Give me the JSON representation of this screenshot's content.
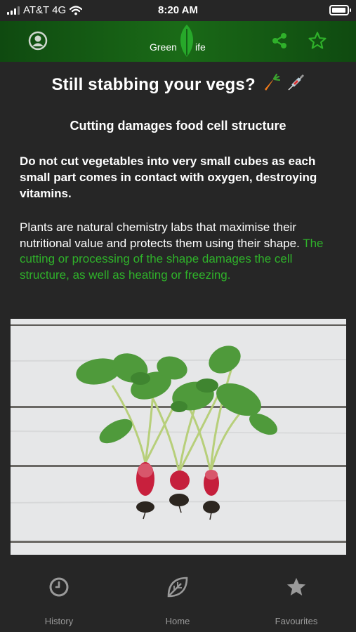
{
  "status_bar": {
    "carrier": "AT&T 4G",
    "time": "8:20 AM"
  },
  "header": {
    "logo_left": "Green",
    "logo_right": "ife",
    "icons": [
      "user-icon",
      "share-icon",
      "star-outline-icon"
    ],
    "accent_color": "#2fb12a"
  },
  "article": {
    "title": "Still stabbing your vegs?",
    "title_emoji": [
      "carrot-emoji",
      "syringe-emoji"
    ],
    "subtitle": "Cutting damages food cell structure",
    "bold_paragraph": "Do not cut vegetables into very small cubes as each small part comes in contact with oxygen, destroying vitamins.",
    "paragraph_plain": "Plants are natural chemistry labs that maximise their nutritional value and protects them using their shape.",
    "paragraph_highlight": "The cutting or processing of the shape damages the cell structure, as well as heating or freezing.",
    "image_subject": "radishes-on-white-wood"
  },
  "tab_bar": {
    "tabs": [
      {
        "label": "History",
        "icon": "clock-icon"
      },
      {
        "label": "Home",
        "icon": "leaf-icon"
      },
      {
        "label": "Favourites",
        "icon": "star-icon"
      }
    ]
  }
}
